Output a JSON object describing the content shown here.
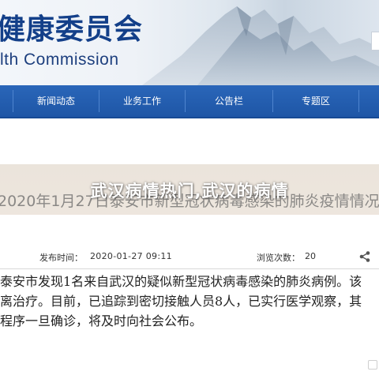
{
  "header": {
    "title": "健康委员会",
    "subtitle": "lth Commission"
  },
  "nav": {
    "items": [
      {
        "label": "新闻动态"
      },
      {
        "label": "业务工作"
      },
      {
        "label": "公告栏"
      },
      {
        "label": "专题区"
      }
    ]
  },
  "overlay": {
    "caption": "武汉病情热门,武汉的病情"
  },
  "article": {
    "title": "2020年1月27日泰安市新型冠状病毒感染的肺炎疫情情况",
    "publish_date": "2020-01-27 09:11",
    "view_count": "20",
    "labels": {
      "publish": "发布时间：",
      "views": "浏览次数："
    },
    "body_lines": [
      "泰安市发现1名来自武汉的疑似新型冠状病毒感染的肺炎病例。该",
      "离治疗。目前，已追踪到密切接触人员8人，已实行医学观察，其",
      "程序一旦确诊，将及时向社会公布。"
    ]
  },
  "colors": {
    "brand_blue": "#133f89",
    "nav_blue": "#1e56a6"
  }
}
